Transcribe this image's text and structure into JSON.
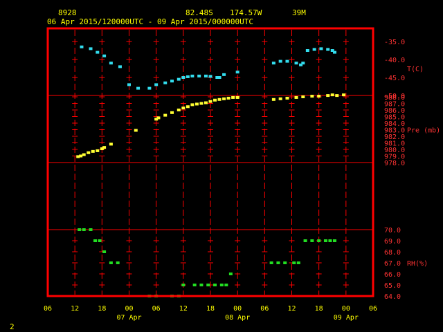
{
  "header": {
    "station_id": "8928",
    "latitude": "82.48S",
    "longitude": "174.57W",
    "elevation": "39M",
    "time_range": "06 Apr 2015/120000UTC - 09 Apr 2015/000000UTC"
  },
  "footer_text": "2",
  "colors": {
    "frame": "#ff0000",
    "text": "#ffff00",
    "temperature": "#33ddee",
    "pressure": "#ffff33",
    "humidity": "#22dd22",
    "axis_labels": "#ff3333"
  },
  "chart_data": {
    "type": "scatter",
    "x_axis": {
      "unit": "hours since 06 Apr 2015 06 UTC",
      "ticks": [
        {
          "hour": 0,
          "label": "06"
        },
        {
          "hour": 6,
          "label": "12"
        },
        {
          "hour": 12,
          "label": "18"
        },
        {
          "hour": 18,
          "label": "00"
        },
        {
          "hour": 24,
          "label": "06"
        },
        {
          "hour": 30,
          "label": "12"
        },
        {
          "hour": 36,
          "label": "18"
        },
        {
          "hour": 42,
          "label": "00"
        },
        {
          "hour": 48,
          "label": "06"
        },
        {
          "hour": 54,
          "label": "12"
        },
        {
          "hour": 60,
          "label": "18"
        },
        {
          "hour": 66,
          "label": "00"
        },
        {
          "hour": 72,
          "label": "06"
        }
      ],
      "date_labels": [
        {
          "hour": 18,
          "label": "07 Apr"
        },
        {
          "hour": 42,
          "label": "08 Apr"
        },
        {
          "hour": 66,
          "label": "09 Apr"
        }
      ]
    },
    "panels": [
      {
        "name": "T(C)",
        "ticks": [
          "-35.0",
          "-40.0",
          "-45.0",
          "-50.0"
        ],
        "ylim": [
          -50,
          -33.5
        ],
        "x": [
          7.5,
          9.5,
          11,
          12.5,
          14,
          16,
          18,
          20,
          22.5,
          24,
          26,
          27.5,
          29,
          30,
          31,
          32,
          33.5,
          35,
          36,
          37.5,
          38,
          39,
          42,
          50,
          51.5,
          53,
          55,
          56,
          56.5,
          57.5,
          59,
          60.5,
          62,
          63,
          63.5
        ],
        "values": [
          -36.5,
          -37,
          -38,
          -39,
          -41,
          -42,
          -47,
          -48,
          -48,
          -47,
          -46.5,
          -46,
          -45.5,
          -45,
          -44.8,
          -44.6,
          -44.6,
          -44.6,
          -44.7,
          -45,
          -45,
          -44.2,
          -43.5,
          -41,
          -40.5,
          -40.5,
          -41,
          -41.5,
          -41,
          -37.5,
          -37.2,
          -37,
          -37.2,
          -37.5,
          -38
        ]
      },
      {
        "name": "Pre (mb)",
        "ticks": [
          "988.0",
          "987.0",
          "986.0",
          "985.0",
          "984.0",
          "983.0",
          "982.0",
          "981.0",
          "980.0",
          "979.0",
          "978.0"
        ],
        "ylim": [
          978,
          988.8
        ],
        "x": [
          6.7,
          7.3,
          8,
          9,
          10,
          11,
          12,
          12.5,
          14,
          19.5,
          24,
          24.5,
          26,
          27.5,
          29,
          30,
          31,
          32,
          33,
          34,
          35,
          36,
          37,
          38,
          39,
          40,
          41,
          42,
          50,
          51.5,
          53,
          55,
          56.5,
          58.5,
          60,
          62,
          63,
          64,
          65.5
        ],
        "values": [
          978.9,
          979,
          979.2,
          979.5,
          979.7,
          979.8,
          980.1,
          980.3,
          980.8,
          982.9,
          984.6,
          984.8,
          985.2,
          985.6,
          986,
          986.3,
          986.5,
          986.8,
          986.9,
          987,
          987.1,
          987.3,
          987.5,
          987.6,
          987.7,
          987.8,
          987.9,
          987.9,
          987.6,
          987.7,
          987.8,
          987.9,
          988,
          988.1,
          988.1,
          988.2,
          988.3,
          988.2,
          988.3
        ]
      },
      {
        "name": "RH(%)",
        "ticks": [
          "70.0",
          "69.0",
          "68.0",
          "67.0",
          "66.0",
          "65.0",
          "64.0"
        ],
        "ylim": [
          64,
          71
        ],
        "x": [
          7,
          8,
          9.5,
          10.5,
          11.5,
          12.5,
          14,
          15.5,
          22.5,
          24,
          27.5,
          29,
          30,
          32.5,
          34,
          35.5,
          37,
          38.5,
          39.5,
          40.5,
          49.5,
          51,
          52.5,
          54.5,
          55.5,
          57,
          58.5,
          60,
          61.5,
          62.5,
          63.5
        ],
        "values": [
          70,
          70,
          70,
          69,
          69,
          68,
          67,
          67,
          64,
          64,
          64,
          64,
          65,
          65,
          65,
          65,
          65,
          65,
          65,
          66,
          67,
          67,
          67,
          67,
          67,
          69,
          69,
          69,
          69,
          69,
          69
        ]
      }
    ]
  }
}
